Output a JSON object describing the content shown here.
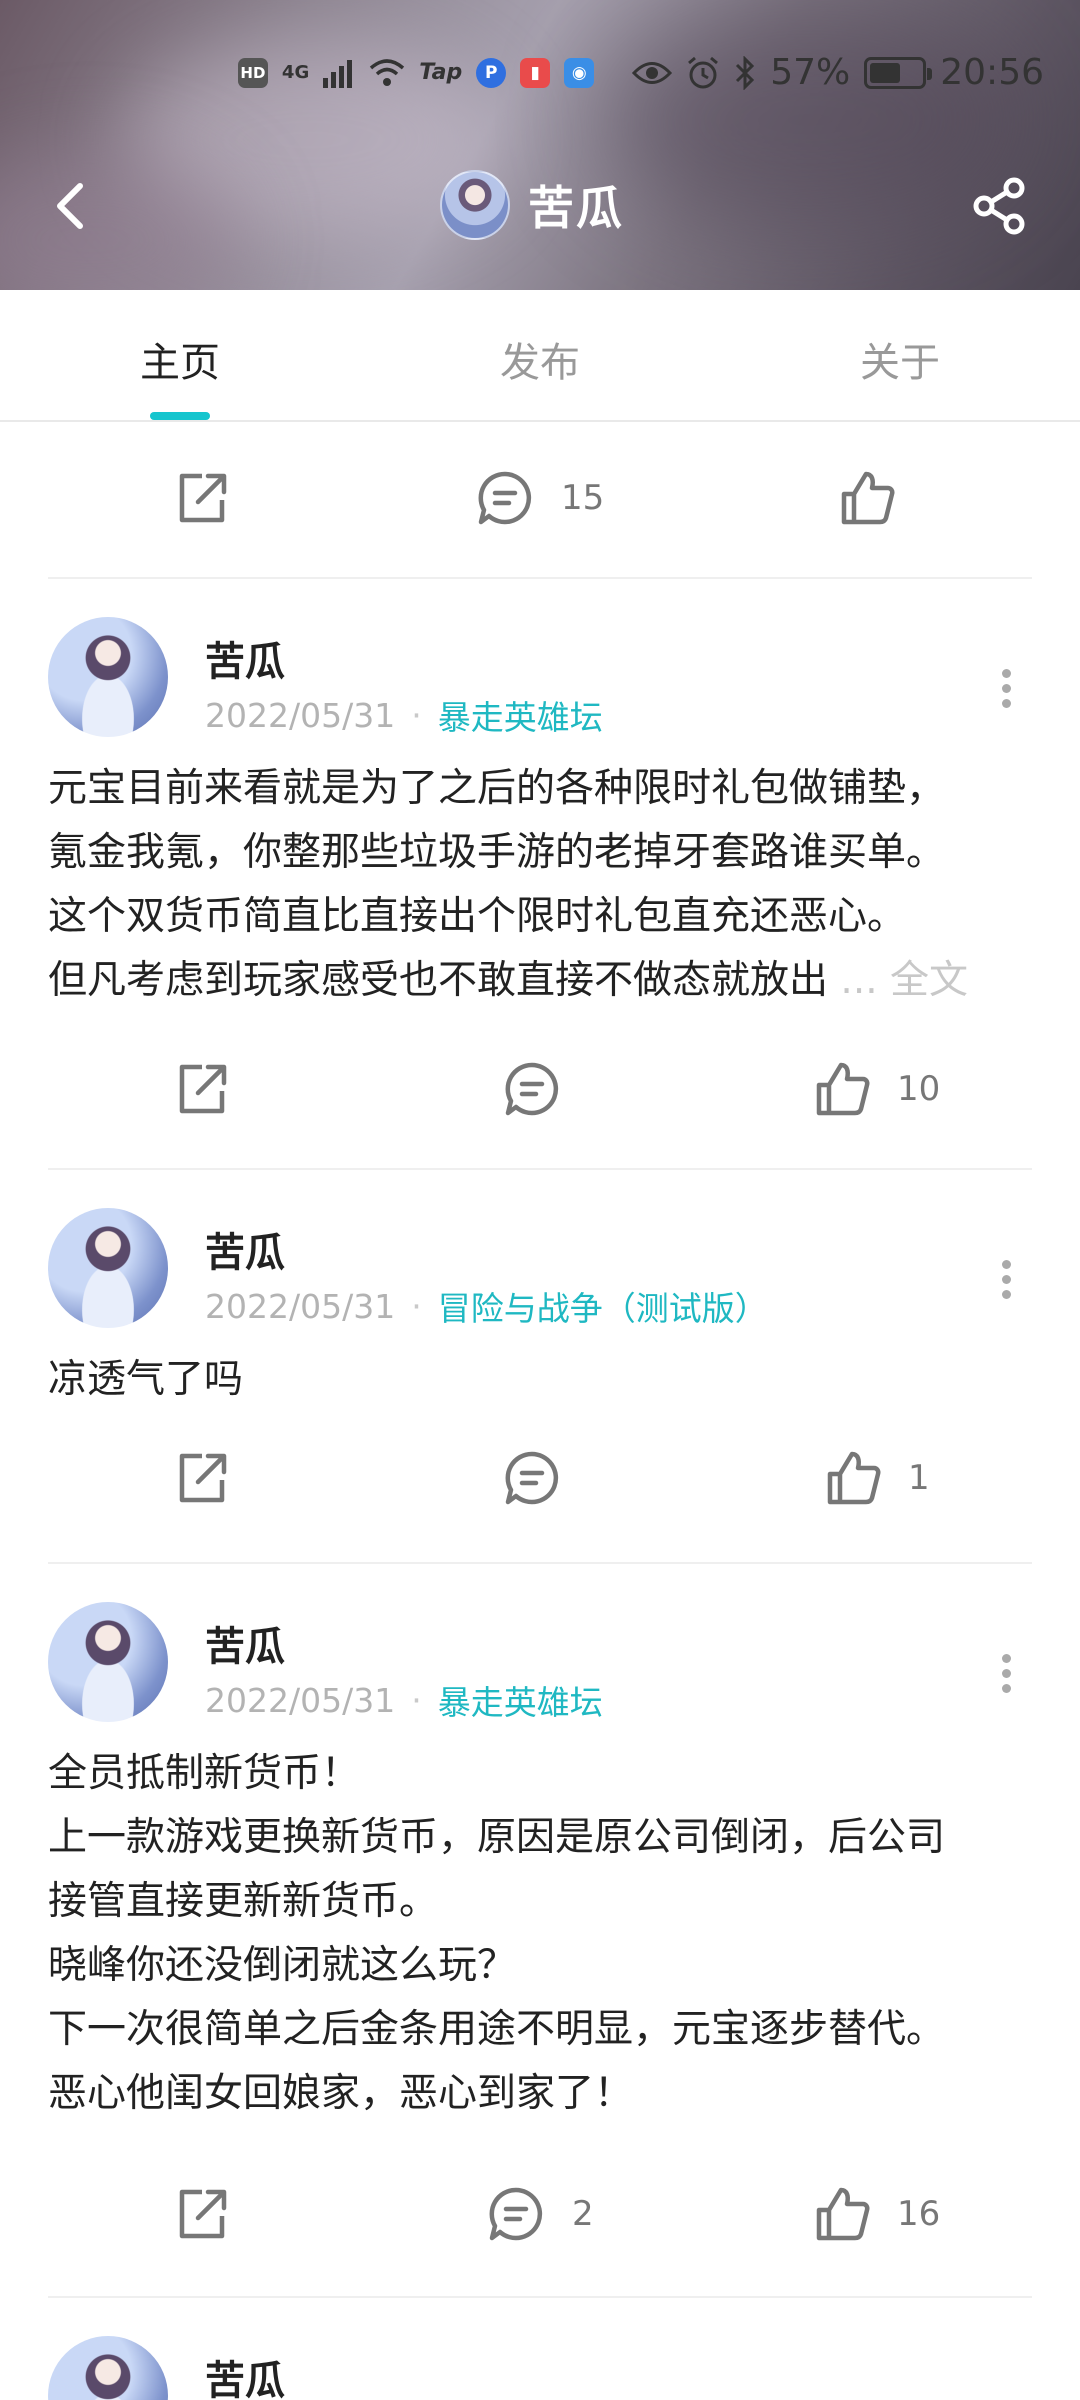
{
  "status_bar": {
    "hd": "HD",
    "network": "4G",
    "tap_label": "Tap",
    "battery_pct": "57%",
    "time": "20:56"
  },
  "header": {
    "title": "苦瓜",
    "back_icon": "chevron-left-icon",
    "share_icon": "share-icon"
  },
  "tabs": [
    {
      "label": "主页",
      "active": true
    },
    {
      "label": "发布",
      "active": false
    },
    {
      "label": "关于",
      "active": false
    }
  ],
  "top_actions": {
    "comment_count": "15",
    "like_count": ""
  },
  "posts": [
    {
      "author": "苦瓜",
      "date": "2022/05/31",
      "forum": "暴走英雄坛",
      "lines": [
        "元宝目前来看就是为了之后的各种限时礼包做铺垫，",
        "氪金我氪，你整那些垃圾手游的老掉牙套路谁买单。",
        "这个双货币简直比直接出个限时礼包直充还恶心。",
        "但凡考虑到玩家感受也不敢直接不做态就放出"
      ],
      "more_label": "... 全文",
      "comment_count": "",
      "like_count": "10"
    },
    {
      "author": "苦瓜",
      "date": "2022/05/31",
      "forum": "冒险与战争（测试版）",
      "lines": [
        "凉透气了吗"
      ],
      "comment_count": "",
      "like_count": "1"
    },
    {
      "author": "苦瓜",
      "date": "2022/05/31",
      "forum": "暴走英雄坛",
      "lines": [
        "全员抵制新货币！",
        "上一款游戏更换新货币，原因是原公司倒闭，后公司",
        "接管直接更新新货币。",
        "晓峰你还没倒闭就这么玩？",
        "下一次很简单之后金条用途不明显，元宝逐步替代。",
        "恶心他闺女回娘家，恶心到家了！"
      ],
      "comment_count": "2",
      "like_count": "16"
    },
    {
      "author": "苦瓜"
    }
  ],
  "colors": {
    "accent": "#15c5ce",
    "forum_link": "#1fb8c2"
  }
}
